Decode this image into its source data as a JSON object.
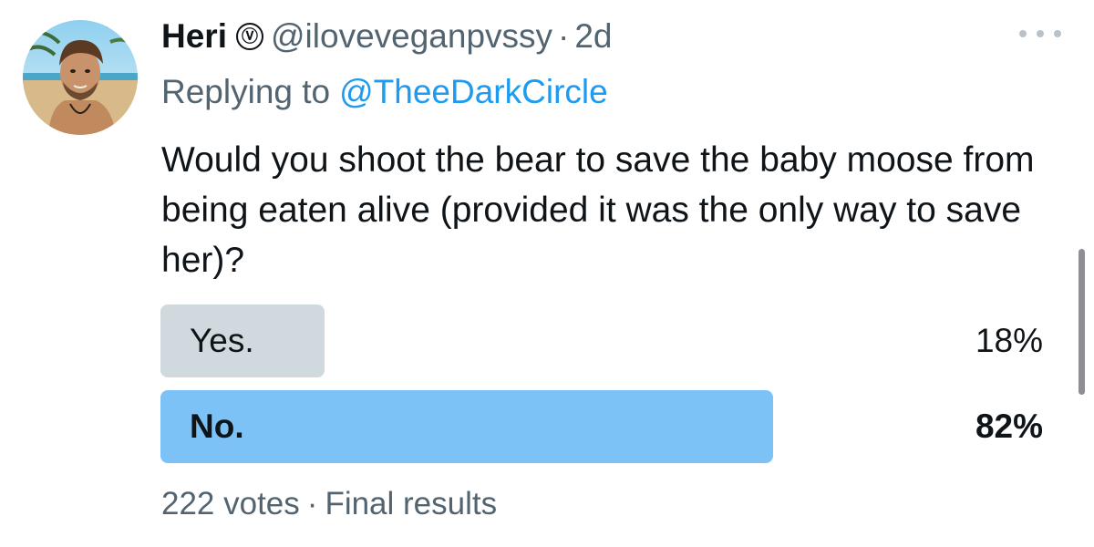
{
  "tweet": {
    "author_name": "Heri",
    "verified_badge": "Ⓥ",
    "handle": "@iloveveganpvssy",
    "separator": "·",
    "time_ago": "2d",
    "reply_prefix": "Replying to",
    "reply_to": "@TheeDarkCircle",
    "text": "Would you shoot the bear to save the baby moose from being eaten alive (provided it was the only way to save her)?",
    "more_icon": "more-horizontal-icon"
  },
  "poll": {
    "options": [
      {
        "label": "Yes.",
        "percent_text": "18%",
        "percent": 18,
        "bar_color": "#cfd9de",
        "winner": false
      },
      {
        "label": "No.",
        "percent_text": "82%",
        "percent": 82,
        "bar_color": "#7cc2f6",
        "winner": true
      }
    ],
    "votes": "222 votes",
    "separator": "·",
    "status": "Final results"
  },
  "colors": {
    "text_primary": "#0f1419",
    "text_secondary": "#536471",
    "link": "#1d9bf0"
  }
}
